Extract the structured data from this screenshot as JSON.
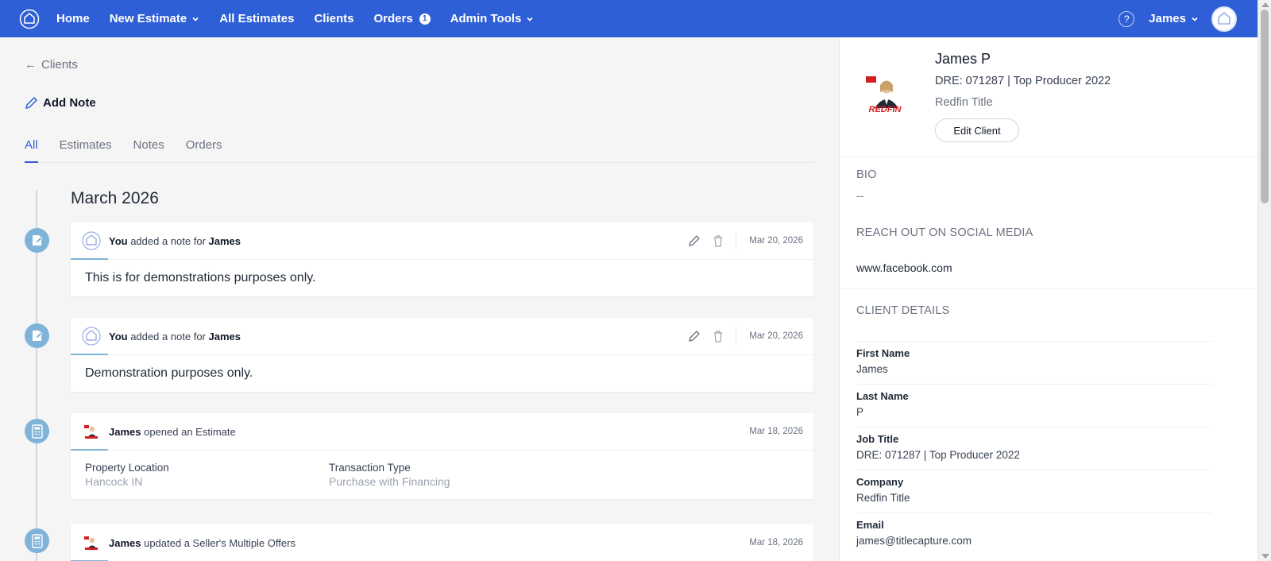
{
  "nav": {
    "home": "Home",
    "new_estimate": "New Estimate",
    "all_estimates": "All Estimates",
    "clients": "Clients",
    "orders": "Orders",
    "orders_badge": "1",
    "admin_tools": "Admin Tools",
    "help": "?",
    "user": "James",
    "brand_color": "#2f5fd6"
  },
  "main": {
    "back_label": "Clients",
    "add_note_label": "Add Note",
    "tabs": [
      {
        "label": "All",
        "active": true
      },
      {
        "label": "Estimates"
      },
      {
        "label": "Notes"
      },
      {
        "label": "Orders"
      }
    ],
    "month": "March 2026",
    "activities": [
      {
        "actor": "You",
        "middle": " added a note for ",
        "subject": "James",
        "suffix": "",
        "date": "Mar 20, 2026",
        "body": "This is for demonstrations purposes only."
      },
      {
        "actor": "You",
        "middle": " added a note for ",
        "subject": "James",
        "suffix": "",
        "date": "Mar 20, 2026",
        "body": "Demonstration purposes only."
      },
      {
        "actor": "James",
        "middle": " opened an Estimate",
        "subject": "",
        "date": "Mar 18, 2026",
        "fields": [
          {
            "label": "Property Location",
            "value": "Hancock IN"
          },
          {
            "label": "Transaction Type",
            "value": "Purchase with Financing"
          }
        ]
      },
      {
        "actor": "James",
        "middle": " updated a Seller's Multiple Offers",
        "subject": "",
        "date": "Mar 18, 2026"
      }
    ]
  },
  "profile": {
    "name": "James P",
    "job": "DRE: 071287 | Top Producer 2022",
    "company": "Redfin Title",
    "edit_label": "Edit Client",
    "photo_brand": "REDFIN",
    "bio_title": "BIO",
    "bio_value": "--",
    "social_title": "REACH OUT ON SOCIAL MEDIA",
    "social_value": "www.facebook.com",
    "details_title": "CLIENT DETAILS",
    "details": [
      {
        "label": "First Name",
        "value": "James"
      },
      {
        "label": "Last Name",
        "value": "P"
      },
      {
        "label": "Job Title",
        "value": "DRE: 071287 | Top Producer 2022"
      },
      {
        "label": "Company",
        "value": "Redfin Title"
      },
      {
        "label": "Email",
        "value": "james@titlecapture.com"
      }
    ]
  }
}
